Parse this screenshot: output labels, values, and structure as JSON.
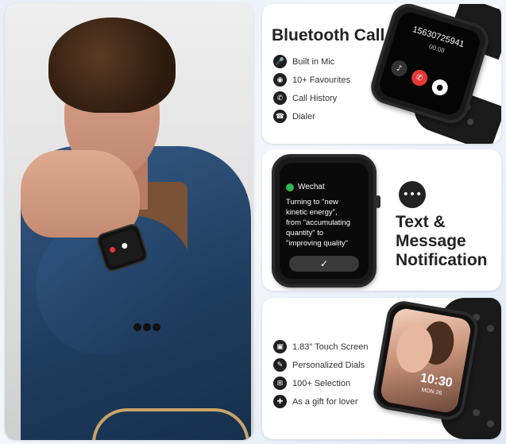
{
  "bluetooth_panel": {
    "title": "Bluetooth Call",
    "features": [
      {
        "icon": "microphone-icon",
        "glyph": "🎤",
        "label": "Built in Mic"
      },
      {
        "icon": "camera-icon",
        "glyph": "◉",
        "label": "10+ Favourites"
      },
      {
        "icon": "phone-icon",
        "glyph": "✆",
        "label": "Call History"
      },
      {
        "icon": "dialer-icon",
        "glyph": "☎",
        "label": "Dialer"
      }
    ],
    "watch": {
      "number": "15630725941",
      "time": "00:08"
    }
  },
  "message_panel": {
    "title_lines": [
      "Text &",
      "Message",
      "Notification"
    ],
    "watch": {
      "app": "Wechat",
      "message_lines": [
        "Turning to \"new",
        "kinetic energy\",",
        "from \"accumulating",
        "quantity\" to",
        "\"improving quality\""
      ],
      "confirm_glyph": "✓"
    }
  },
  "touch_panel": {
    "features": [
      {
        "icon": "screen-size-icon",
        "glyph": "▣",
        "label": "1.83\"  Touch Screen"
      },
      {
        "icon": "edit-icon",
        "glyph": "✎",
        "label": "Personalized Dials"
      },
      {
        "icon": "grid-icon",
        "glyph": "⊞",
        "label": "100+ Selection"
      },
      {
        "icon": "gift-icon",
        "glyph": "✚",
        "label": "As a gift for lover"
      }
    ],
    "watch": {
      "time": "10:30",
      "date": "MON 26"
    }
  },
  "colors": {
    "answer": "#2fb84b",
    "decline": "#e53935",
    "text": "#222222"
  }
}
